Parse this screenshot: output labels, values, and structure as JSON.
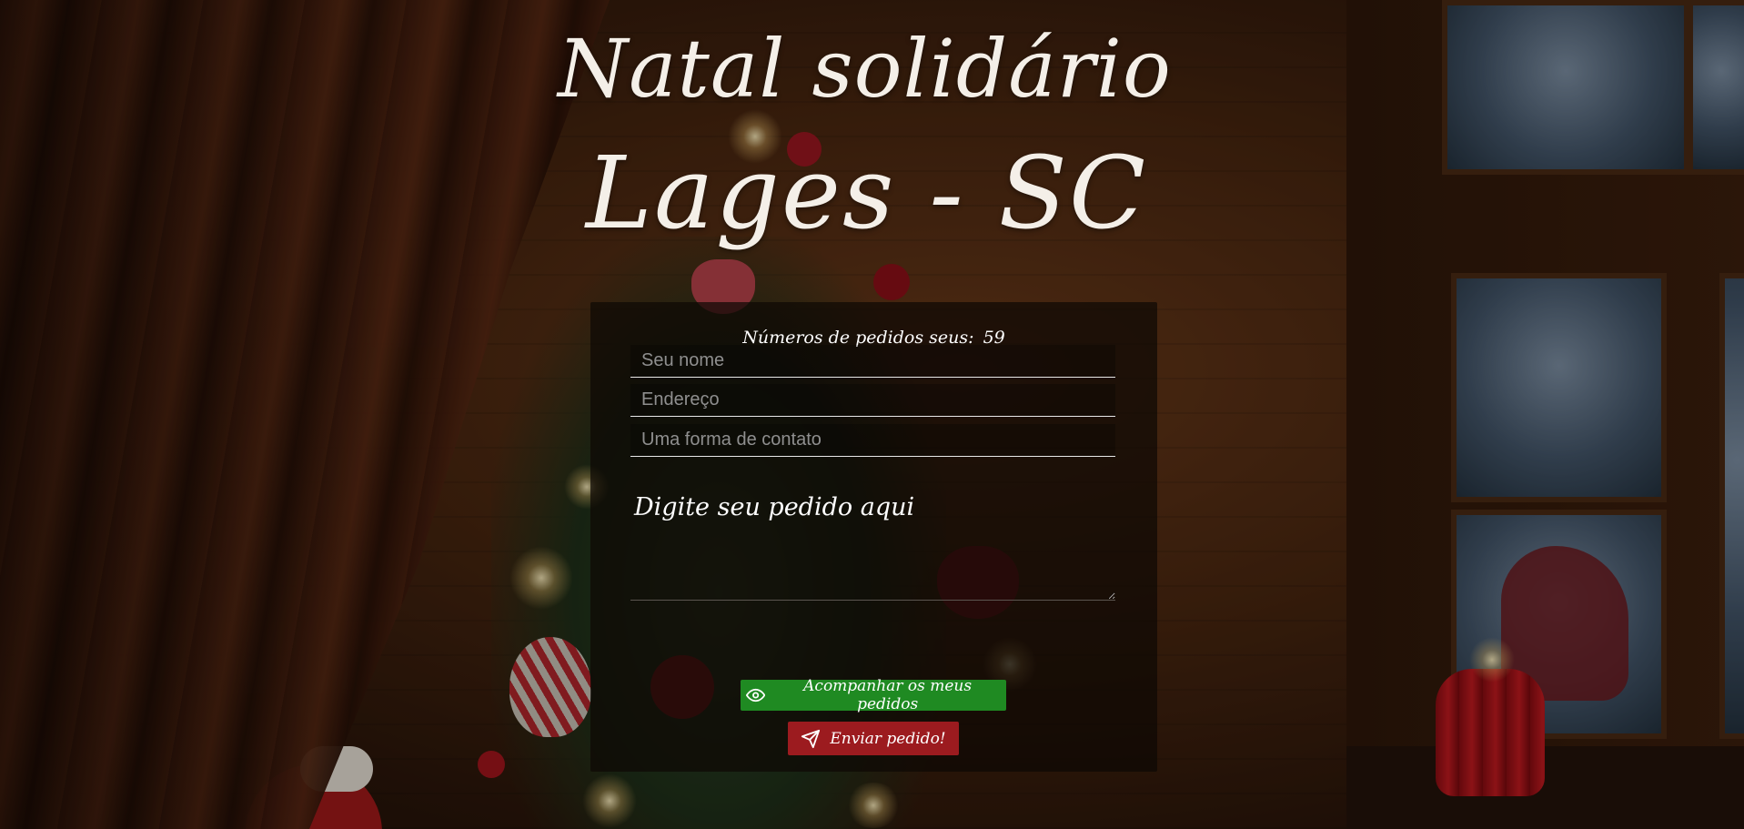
{
  "page": {
    "title_line1": "Natal solidário",
    "title_line2": "Lages - SC"
  },
  "form": {
    "counter_label": "Números de pedidos seus:",
    "counter_value": "59",
    "name_placeholder": "Seu nome",
    "address_placeholder": "Endereço",
    "contact_placeholder": "Uma forma de contato",
    "request_placeholder": "Digite seu pedido aqui",
    "track_button_label": "Acompanhar os meus pedidos",
    "send_button_label": "Enviar pedido!"
  },
  "icons": {
    "track": "eye-icon",
    "send": "paper-plane-icon"
  },
  "colors": {
    "track_button": "#1f8a22",
    "send_button": "#9c1b1f",
    "panel": "rgba(14,8,4,0.72)",
    "title_text": "#f4efe8"
  }
}
